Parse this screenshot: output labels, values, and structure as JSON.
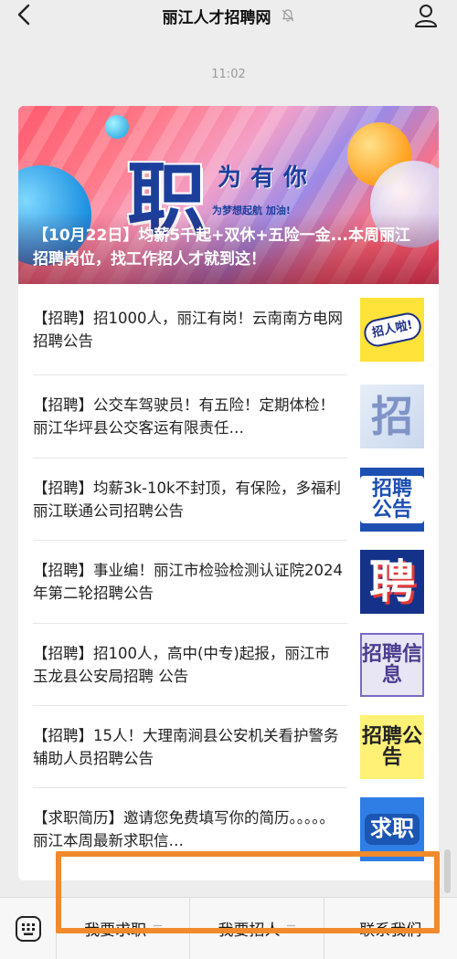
{
  "header": {
    "title": "丽江人才招聘网"
  },
  "timestamp": "11:02",
  "banner": {
    "big_char": "职",
    "slogan": "为有你",
    "sub": "为梦想起航 加油!",
    "headline": "【10月22日】均薪5千起+双休+五险一金...本周丽江招聘岗位，找工作招人才就到这！"
  },
  "articles": [
    {
      "title": "【招聘】招1000人，丽江有岗！云南南方电网招聘公告",
      "thumb_text": "招人啦!"
    },
    {
      "title": "【招聘】公交车驾驶员！有五险！定期体检！丽江华坪县公交客运有限责任…",
      "thumb_text": "招"
    },
    {
      "title": "【招聘】均薪3k-10k不封顶，有保险，多福利丽江联通公司招聘公告",
      "thumb_text": "招聘公告"
    },
    {
      "title": "【招聘】事业编！丽江市检验检测认证院2024年第二轮招聘公告",
      "thumb_text": "聘"
    },
    {
      "title": "【招聘】招100人，高中(中专)起报，丽江市玉龙县公安局招聘 公告",
      "thumb_text": "招聘信息"
    },
    {
      "title": "【招聘】15人！大理南涧县公安机关看护警务辅助人员招聘公告",
      "thumb_text": "招聘公告"
    },
    {
      "title": "【求职简历】邀请您免费填写你的简历。。。。。丽江本周最新求职信…",
      "thumb_text": "求职"
    }
  ],
  "bottom_menu": {
    "items": [
      "我要求职",
      "我要招人",
      "联系我们"
    ]
  },
  "colors": {
    "accent_frame": "#f08a2c",
    "background": "#ededed"
  }
}
